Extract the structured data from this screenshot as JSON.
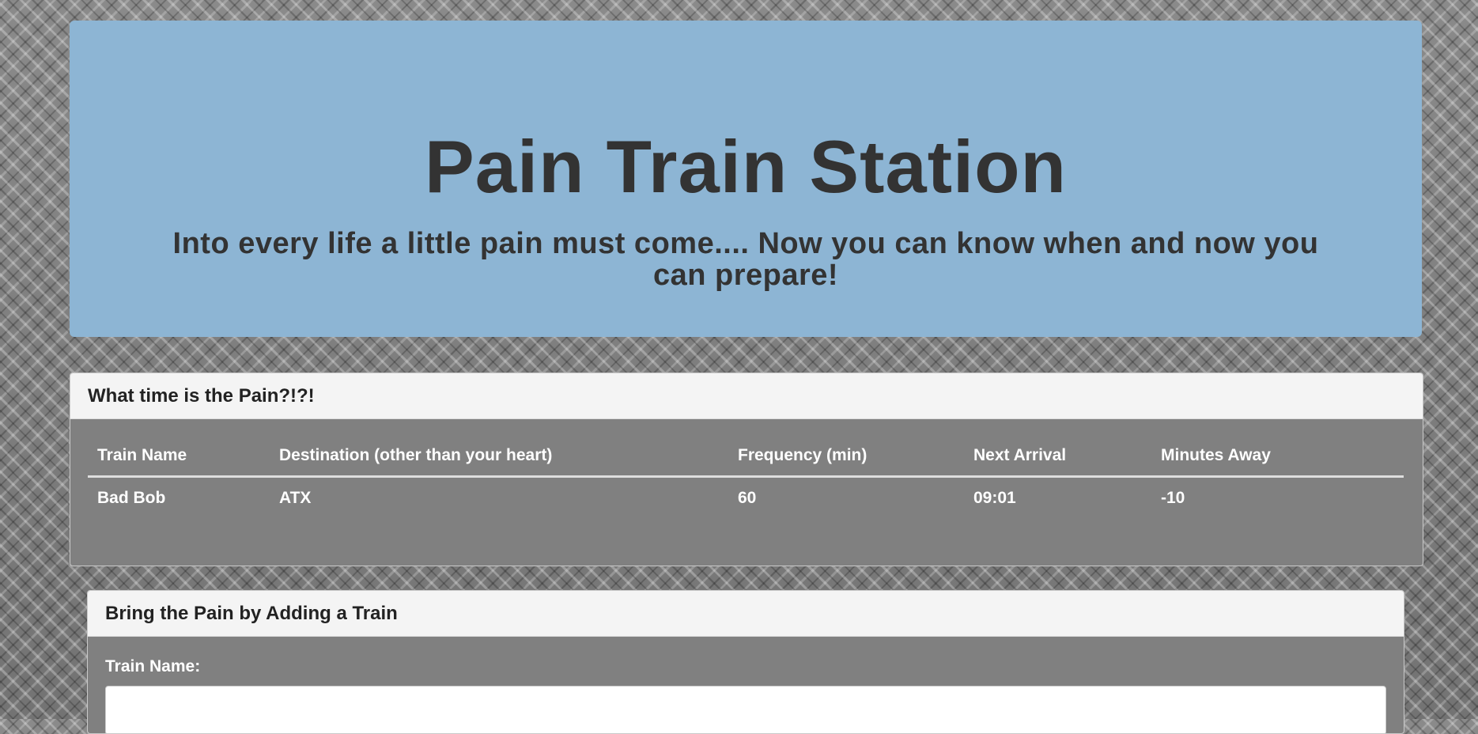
{
  "header": {
    "title": "Pain Train Station",
    "subtitle": "Into every life a little pain must come.... Now you can know when and now you can prepare!"
  },
  "schedule": {
    "heading": "What time is the Pain?!?!",
    "columns": [
      "Train Name",
      "Destination (other than your heart)",
      "Frequency (min)",
      "Next Arrival",
      "Minutes Away"
    ],
    "rows": [
      [
        "Bad Bob",
        "ATX",
        "60",
        "09:01",
        "-10"
      ]
    ]
  },
  "add_train": {
    "heading": "Bring the Pain by Adding a Train",
    "train_name_label": "Train Name:",
    "train_name_value": "",
    "train_name_placeholder": ""
  }
}
